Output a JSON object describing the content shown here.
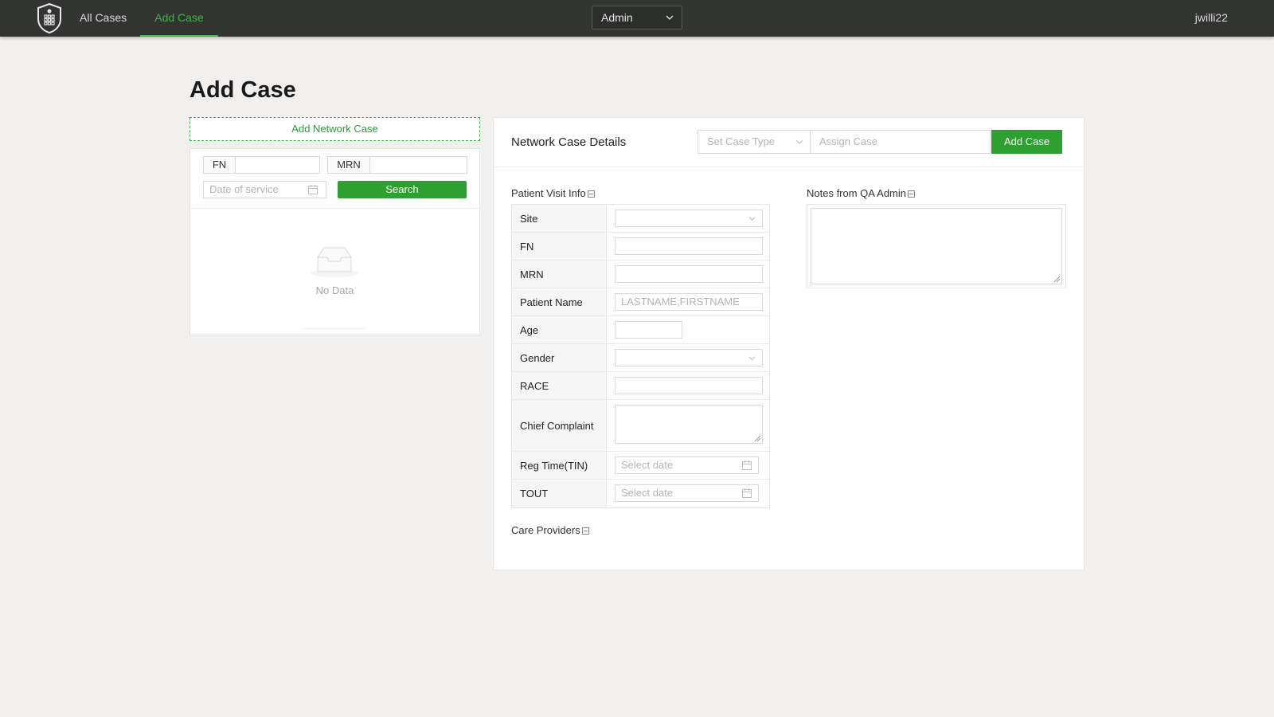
{
  "nav": {
    "all_cases": "All Cases",
    "add_case": "Add Case",
    "role": "Admin",
    "user": "jwilli22"
  },
  "page": {
    "title": "Add Case"
  },
  "network_search": {
    "add_network_case": "Add Network Case",
    "fn_label": "FN",
    "fn_value": "",
    "mrn_label": "MRN",
    "mrn_value": "",
    "date_placeholder": "Date of service",
    "search_label": "Search",
    "empty_text": "No Data"
  },
  "details": {
    "title": "Network Case Details",
    "case_type_placeholder": "Set Case Type",
    "assign_placeholder": "Assign Case",
    "add_case_label": "Add Case",
    "patient_visit_info": "Patient Visit Info",
    "notes_title": "Notes from QA Admin",
    "care_providers": "Care Providers",
    "fields": [
      {
        "label": "Site",
        "value": ""
      },
      {
        "label": "FN",
        "value": ""
      },
      {
        "label": "MRN",
        "value": ""
      },
      {
        "label": "Patient Name",
        "placeholder": "LASTNAME,FIRSTNAME"
      },
      {
        "label": "Age",
        "value": ""
      },
      {
        "label": "Gender",
        "value": ""
      },
      {
        "label": "RACE",
        "value": ""
      },
      {
        "label": "Chief Complaint",
        "value": ""
      },
      {
        "label": "Reg Time(TIN)",
        "placeholder": "Select date"
      },
      {
        "label": "TOUT",
        "placeholder": "Select date"
      }
    ]
  },
  "colors": {
    "accent": "#2e9f31",
    "nav_bg": "#323432",
    "page_bg": "#f2f0ef"
  }
}
